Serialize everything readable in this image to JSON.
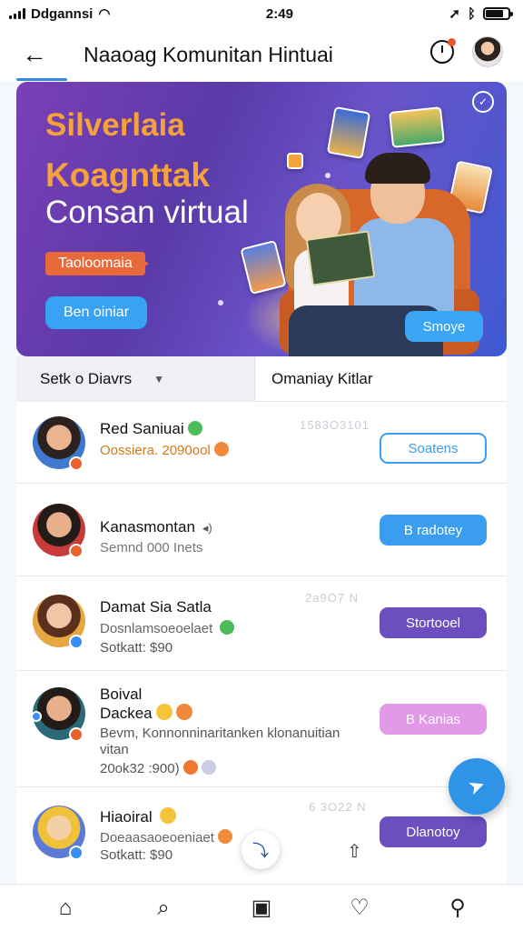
{
  "status": {
    "carrier": "Ddgannsi",
    "time": "2:49"
  },
  "header": {
    "title": "Naaoag Komunitan Hintuai"
  },
  "banner": {
    "line1": "Silverlaia",
    "line2": "Koagnttak",
    "line3": "Consan virtual",
    "tag": "Taoloomaia",
    "button_left": "Ben oiniar",
    "button_right": "Smoye"
  },
  "filters": {
    "left_label": "Setk o Diavrs",
    "right_label": "Omaniay Kitlar"
  },
  "rows": [
    {
      "name": "Red Saniuai",
      "sub": "Oossiera. 2090ool",
      "meta": "1583O3101",
      "button": "Soatens"
    },
    {
      "name": "Kanasmontan",
      "sub": "Semnd 000 Inets",
      "meta": "",
      "button": "B radotey"
    },
    {
      "name": "Damat Sia Satla",
      "sub": "Dosnlamsoeoelaet",
      "sub2": "Sotkatt: $90",
      "meta": "2a9O7 N",
      "button": "Stortooel"
    },
    {
      "name": "Boival",
      "name2": "Dackea",
      "sub": "Bevm, Konnonninaritanken klonanuitian",
      "sub2": "vitan",
      "sub3": "20ok32 :900)",
      "meta": "",
      "button": "B Kanias"
    },
    {
      "name": "Hiaoiral",
      "sub": "Doeaasaoeoeniaet",
      "sub2": "Sotkatt: $90",
      "meta": "6 3O22 N",
      "button": "Dlanotoy"
    }
  ],
  "colors": {
    "accent": "#2f94e8",
    "banner_orange": "#f6a23b",
    "purple_button": "#6b4fbf",
    "pink_button": "#d98ae6",
    "blue_button": "#3a9df0"
  },
  "icons": [
    "back-arrow-icon",
    "timer-icon",
    "home-icon",
    "search-icon",
    "library-icon",
    "heart-icon",
    "profile-icon",
    "send-icon",
    "share-icon"
  ]
}
